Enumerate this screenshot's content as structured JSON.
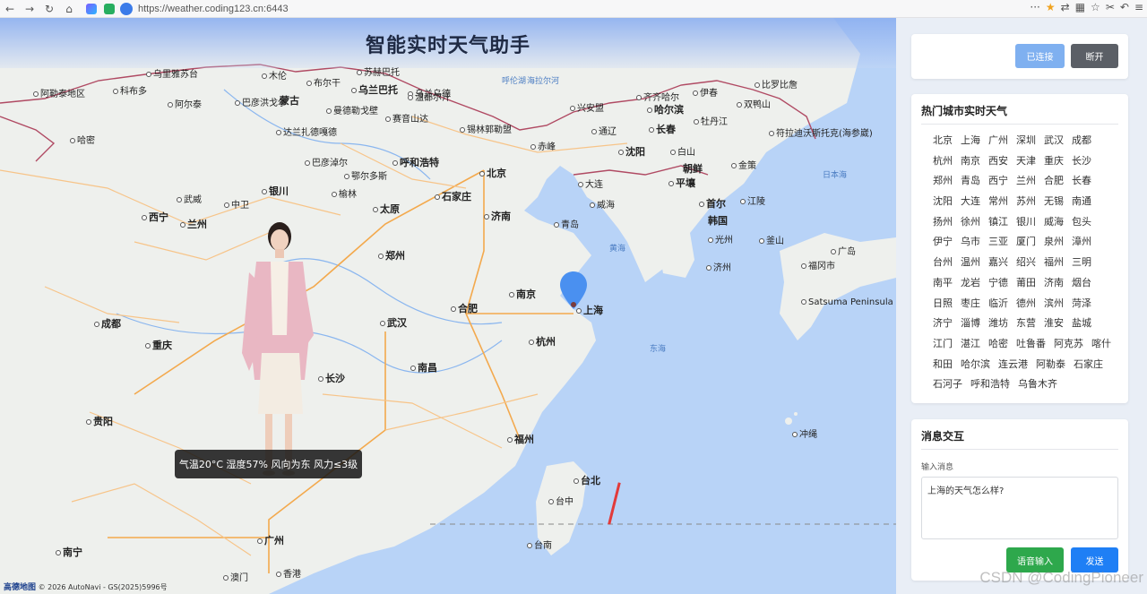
{
  "browser": {
    "url": "https://weather.coding123.cn:6443"
  },
  "app": {
    "title": "智能实时天气助手",
    "caption": "气温20°C 湿度57% 风向为东 风力≤3级",
    "map_logo_brand": "高德地图",
    "map_logo_copy": "© 2026 AutoNavi - GS(2025)5996号",
    "watermark": "CSDN @CodingPioneer"
  },
  "map_labels": [
    {
      "name": "乌里雅苏台",
      "cls": ""
    },
    {
      "name": "木伦",
      "cls": ""
    },
    {
      "name": "苏赫巴托",
      "cls": ""
    },
    {
      "name": "布尔干",
      "cls": ""
    },
    {
      "name": "乌兰巴托",
      "cls": "big"
    },
    {
      "name": "乌兰乌德",
      "cls": ""
    },
    {
      "name": "呼伦湖",
      "cls": "sea-label"
    },
    {
      "name": "海拉尔河",
      "cls": "sea-label"
    },
    {
      "name": "比罗比詹",
      "cls": ""
    },
    {
      "name": "伊春",
      "cls": ""
    },
    {
      "name": "齐齐哈尔",
      "cls": ""
    },
    {
      "name": "双鸭山",
      "cls": ""
    },
    {
      "name": "阿勒泰地区",
      "cls": ""
    },
    {
      "name": "科布多",
      "cls": ""
    },
    {
      "name": "蒙古",
      "cls": "big nodot"
    },
    {
      "name": "巴彦洪戈尔",
      "cls": ""
    },
    {
      "name": "温都尔汗",
      "cls": ""
    },
    {
      "name": "阿尔泰",
      "cls": ""
    },
    {
      "name": "曼德勒戈壁",
      "cls": ""
    },
    {
      "name": "赛音山达",
      "cls": ""
    },
    {
      "name": "兴安盟",
      "cls": ""
    },
    {
      "name": "哈尔滨",
      "cls": "big"
    },
    {
      "name": "牡丹江",
      "cls": ""
    },
    {
      "name": "哈密",
      "cls": ""
    },
    {
      "name": "达兰扎德嘎德",
      "cls": ""
    },
    {
      "name": "锡林郭勒盟",
      "cls": ""
    },
    {
      "name": "通辽",
      "cls": ""
    },
    {
      "name": "长春",
      "cls": "big"
    },
    {
      "name": "符拉迪沃斯托克(海参崴)",
      "cls": ""
    },
    {
      "name": "赤峰",
      "cls": ""
    },
    {
      "name": "沈阳",
      "cls": "big"
    },
    {
      "name": "白山",
      "cls": ""
    },
    {
      "name": "巴彦淖尔",
      "cls": ""
    },
    {
      "name": "呼和浩特",
      "cls": "big"
    },
    {
      "name": "朝鲜",
      "cls": "big nodot"
    },
    {
      "name": "金策",
      "cls": ""
    },
    {
      "name": "鄂尔多斯",
      "cls": ""
    },
    {
      "name": "北京",
      "cls": "big"
    },
    {
      "name": "日本海",
      "cls": "sea-label"
    },
    {
      "name": "银川",
      "cls": "big"
    },
    {
      "name": "榆林",
      "cls": ""
    },
    {
      "name": "大连",
      "cls": ""
    },
    {
      "name": "平壤",
      "cls": "big"
    },
    {
      "name": "首尔",
      "cls": "big"
    },
    {
      "name": "江陵",
      "cls": ""
    },
    {
      "name": "石家庄",
      "cls": "big"
    },
    {
      "name": "武威",
      "cls": ""
    },
    {
      "name": "中卫",
      "cls": ""
    },
    {
      "name": "太原",
      "cls": "big"
    },
    {
      "name": "济南",
      "cls": "big"
    },
    {
      "name": "威海",
      "cls": ""
    },
    {
      "name": "韩国",
      "cls": "big nodot"
    },
    {
      "name": "西宁",
      "cls": "big"
    },
    {
      "name": "兰州",
      "cls": "big"
    },
    {
      "name": "青岛",
      "cls": ""
    },
    {
      "name": "光州",
      "cls": ""
    },
    {
      "name": "釜山",
      "cls": ""
    },
    {
      "name": "郑州",
      "cls": "big"
    },
    {
      "name": "济州",
      "cls": ""
    },
    {
      "name": "黄海",
      "cls": "sea-label"
    },
    {
      "name": "福冈市",
      "cls": ""
    },
    {
      "name": "成都",
      "cls": "big"
    },
    {
      "name": "合肥",
      "cls": "big"
    },
    {
      "name": "南京",
      "cls": "big"
    },
    {
      "name": "上海",
      "cls": "big"
    },
    {
      "name": "重庆",
      "cls": "big"
    },
    {
      "name": "武汉",
      "cls": "big"
    },
    {
      "name": "杭州",
      "cls": "big"
    },
    {
      "name": "东海",
      "cls": "sea-label"
    },
    {
      "name": "长沙",
      "cls": "big"
    },
    {
      "name": "南昌",
      "cls": "big"
    },
    {
      "name": "Satsuma Peninsula",
      "cls": ""
    },
    {
      "name": "贵阳",
      "cls": "big"
    },
    {
      "name": "福州",
      "cls": "big"
    },
    {
      "name": "台北",
      "cls": "big"
    },
    {
      "name": "冲绳",
      "cls": ""
    },
    {
      "name": "南宁",
      "cls": "big"
    },
    {
      "name": "广州",
      "cls": "big"
    },
    {
      "name": "台中",
      "cls": ""
    },
    {
      "name": "台南",
      "cls": ""
    },
    {
      "name": "香港",
      "cls": ""
    },
    {
      "name": "澳门",
      "cls": ""
    },
    {
      "name": "广岛",
      "cls": ""
    }
  ],
  "connection": {
    "connected_label": "已连接",
    "disconnect_label": "断开"
  },
  "hot_cities": {
    "title": "热门城市实时天气",
    "cities": [
      "北京",
      "上海",
      "广州",
      "深圳",
      "武汉",
      "成都",
      "杭州",
      "南京",
      "西安",
      "天津",
      "重庆",
      "长沙",
      "郑州",
      "青岛",
      "西宁",
      "兰州",
      "合肥",
      "长春",
      "沈阳",
      "大连",
      "常州",
      "苏州",
      "无锡",
      "南通",
      "扬州",
      "徐州",
      "镇江",
      "银川",
      "威海",
      "包头",
      "伊宁",
      "乌市",
      "三亚",
      "厦门",
      "泉州",
      "漳州",
      "台州",
      "温州",
      "嘉兴",
      "绍兴",
      "福州",
      "三明",
      "南平",
      "龙岩",
      "宁德",
      "莆田",
      "济南",
      "烟台",
      "日照",
      "枣庄",
      "临沂",
      "德州",
      "滨州",
      "菏泽",
      "济宁",
      "淄博",
      "潍坊",
      "东营",
      "淮安",
      "盐城",
      "江门",
      "湛江",
      "哈密",
      "吐鲁番",
      "阿克苏",
      "喀什",
      "和田",
      "哈尔滨",
      "连云港",
      "阿勒泰",
      "石家庄",
      "石河子",
      "呼和浩特",
      "乌鲁木齐"
    ]
  },
  "messages": {
    "title": "消息交互",
    "input_label": "输入消息",
    "input_value": "上海的天气怎么样?",
    "voice_label": "语音输入",
    "send_label": "发送"
  },
  "colors": {
    "primary": "#1f7ff5",
    "connected": "#7fb0f0",
    "disconnect": "#5b5f66",
    "voice": "#2ea84c",
    "sea": "#b8d3f7",
    "land": "#eef0ed"
  }
}
